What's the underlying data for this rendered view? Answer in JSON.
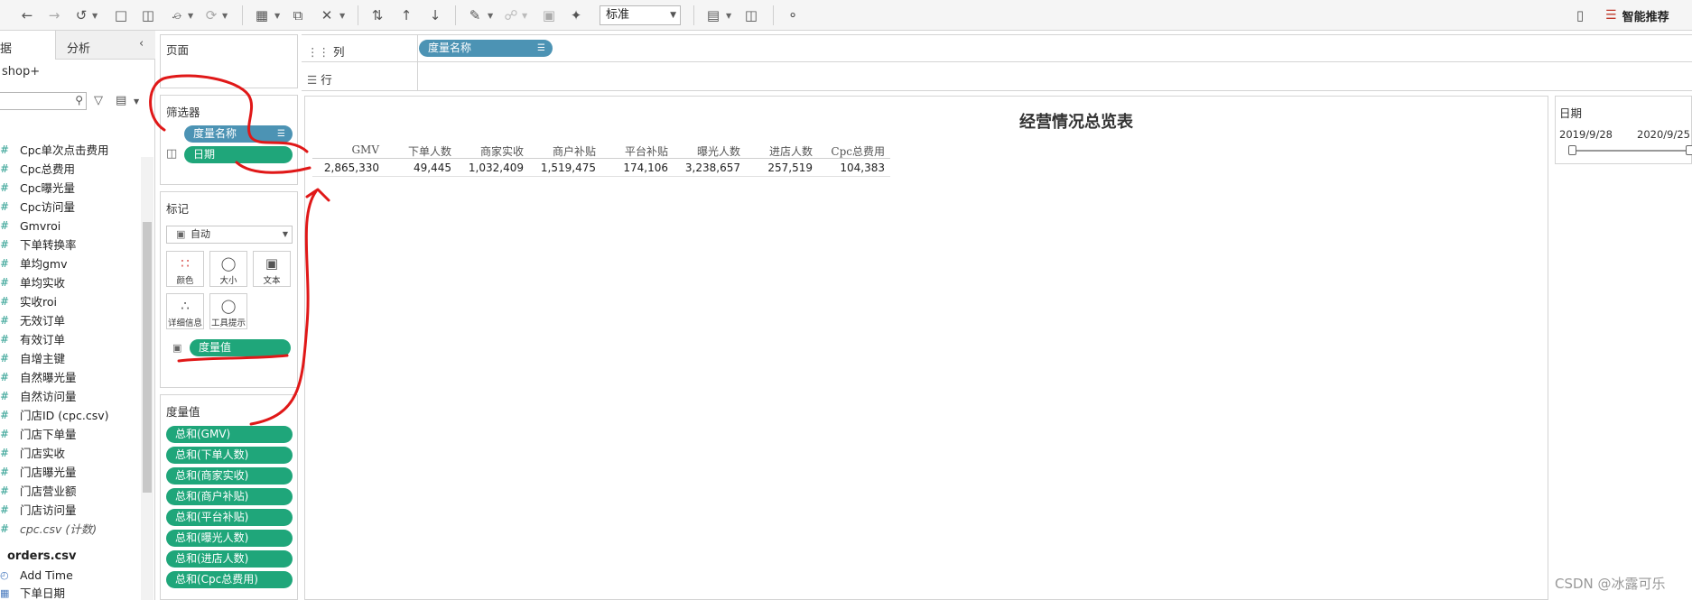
{
  "toolbar": {
    "view_type_value": "标准",
    "smart_label": "智能推荐"
  },
  "left_pane": {
    "tab_data": "据",
    "tab_analysis": "分析",
    "datasource": "shop+",
    "fields": [
      "Cpc单次点击费用",
      "Cpc总费用",
      "Cpc曝光量",
      "Cpc访问量",
      "Gmvroi",
      "下单转换率",
      "单均gmv",
      "单均实收",
      "实收roi",
      "无效订单",
      "有效订单",
      "自增主键",
      "自然曝光量",
      "自然访问量",
      "门店ID (cpc.csv)",
      "门店下单量",
      "门店实收",
      "门店曝光量",
      "门店营业额",
      "门店访问量"
    ],
    "count_field": "cpc.csv (计数)",
    "orders_source": "orders.csv",
    "dim_fields": [
      "Add Time",
      "下单日期"
    ]
  },
  "pages_card": {
    "title": "页面"
  },
  "filters_card": {
    "title": "筛选器",
    "pills": [
      "度量名称",
      "日期"
    ]
  },
  "marks_card": {
    "title": "标记",
    "mark_type": "自动",
    "buttons": [
      "颜色",
      "大小",
      "文本",
      "详细信息",
      "工具提示"
    ],
    "text_pill": "度量值"
  },
  "measure_values_card": {
    "title": "度量值",
    "pills": [
      "总和(GMV)",
      "总和(下单人数)",
      "总和(商家实收)",
      "总和(商户补贴)",
      "总和(平台补贴)",
      "总和(曝光人数)",
      "总和(进店人数)",
      "总和(Cpc总费用)"
    ]
  },
  "columns_shelf": {
    "label": "列",
    "pill": "度量名称"
  },
  "rows_shelf": {
    "label": "行"
  },
  "view": {
    "title": "经营情况总览表",
    "headers": [
      "GMV",
      "下单人数",
      "商家实收",
      "商户补贴",
      "平台补贴",
      "曝光人数",
      "进店人数",
      "Cpc总费用"
    ],
    "values": [
      "2,865,330",
      "49,445",
      "1,032,409",
      "1,519,475",
      "174,106",
      "3,238,657",
      "257,519",
      "104,383"
    ]
  },
  "date_filter": {
    "title": "日期",
    "start": "2019/9/28",
    "end": "2020/9/25",
    "range_fraction": [
      0,
      1
    ]
  },
  "watermark": "CSDN @冰露可乐",
  "colors": {
    "pill_green": "#1fa67a",
    "pill_blue": "#4c93b4",
    "annotation_red": "#e01818"
  }
}
